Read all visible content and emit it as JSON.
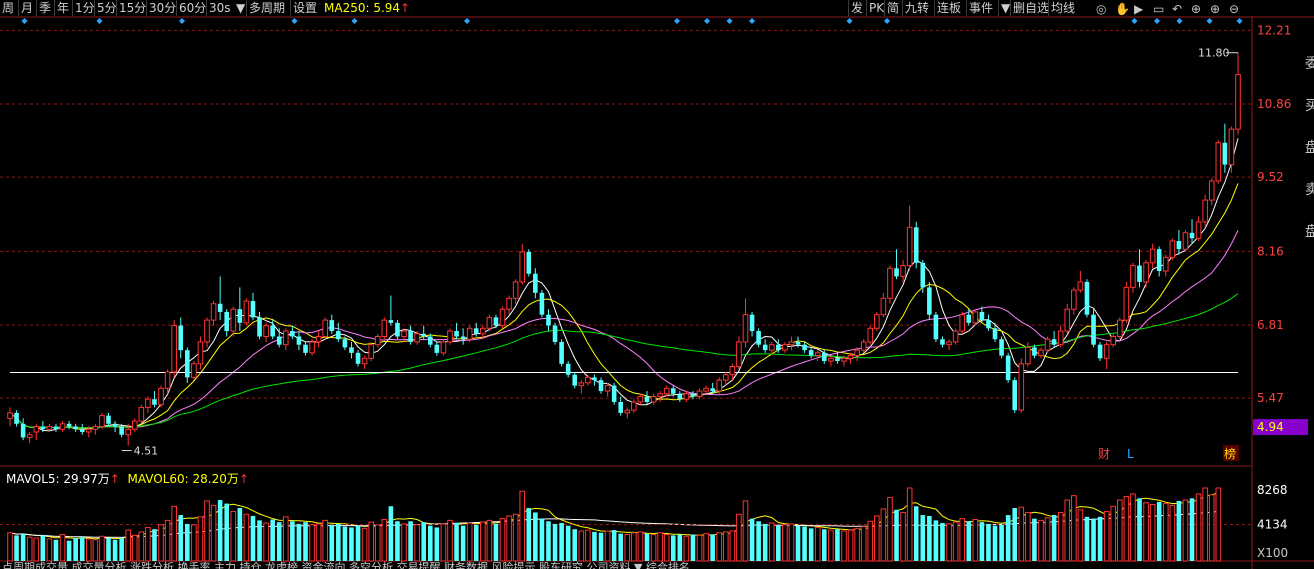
{
  "toolbar": {
    "periods": [
      "周",
      "月",
      "季",
      "年",
      "1分",
      "5分",
      "15分",
      "30分",
      "60分",
      "30s"
    ],
    "dropdown_icon": "▼",
    "multi_period": "多周期",
    "settings": "设置",
    "ma250_label": "MA250: 5.94",
    "ma250_arrow": "↑",
    "right_items": [
      "发",
      "PK",
      "简",
      "九转",
      "连板",
      "事件",
      "▼",
      "删自选",
      "均线"
    ],
    "right_icons": [
      "eye-icon",
      "hand-icon",
      "play-icon",
      "box-icon",
      "undo-icon",
      "crosshair-icon",
      "zoom-in-icon",
      "zoom-out-icon"
    ]
  },
  "price_panel": {
    "y_axis_labels": [
      "12.21",
      "10.86",
      "9.52",
      "8.16",
      "6.81",
      "5.47"
    ],
    "current_price_tag": "4.94",
    "high_label": "11.80",
    "low_label": "4.51",
    "markers": {
      "finance": "财",
      "l_marker": "L",
      "rank": "榜"
    },
    "colors": {
      "up": "#ff3232",
      "down": "#54ffff",
      "ma5": "#ffffff",
      "ma10": "#ffff00",
      "ma20": "#ff80ff",
      "ma60": "#00e600",
      "ma250": "#ffffff",
      "grid": "#8b1a1a",
      "tag_bg": "#8800cc"
    }
  },
  "volume_panel": {
    "mavol5_label": "MAVOL5: 29.97万",
    "mavol5_arrow": "↑",
    "mavol60_label": "MAVOL60: 28.20万",
    "mavol60_arrow": "↑",
    "y_axis_labels": [
      "8268",
      "4134",
      "X100"
    ]
  },
  "right_edge_text": [
    "委",
    "买",
    "盘",
    "卖",
    "盘"
  ],
  "bottom_strip_text": "点周期成交量 成交量分析 涨跌分析 换手率 主力 持仓 龙虎榜 资金流向 多空分析 交易提醒 财务数据 风险提示 股东研究 公司资料 ▼ 综合排名",
  "chart_data": {
    "type": "candlestick",
    "y_range": [
      4.3,
      12.4
    ],
    "candles": [
      [
        5.1,
        5.3,
        4.95,
        5.2
      ],
      [
        5.2,
        5.25,
        4.95,
        5.0
      ],
      [
        5.0,
        5.1,
        4.7,
        4.75
      ],
      [
        4.75,
        4.85,
        4.65,
        4.8
      ],
      [
        4.85,
        5.0,
        4.7,
        4.95
      ],
      [
        4.95,
        5.05,
        4.85,
        4.9
      ],
      [
        4.9,
        5.0,
        4.85,
        4.95
      ],
      [
        4.95,
        5.0,
        4.85,
        4.9
      ],
      [
        4.9,
        5.05,
        4.85,
        5.0
      ],
      [
        5.0,
        5.05,
        4.9,
        4.95
      ],
      [
        4.95,
        5.0,
        4.85,
        4.9
      ],
      [
        4.9,
        5.0,
        4.8,
        4.85
      ],
      [
        4.85,
        4.95,
        4.75,
        4.9
      ],
      [
        4.9,
        5.0,
        4.8,
        4.95
      ],
      [
        4.95,
        5.2,
        4.9,
        5.15
      ],
      [
        5.15,
        5.2,
        4.95,
        5.0
      ],
      [
        5.0,
        5.05,
        4.85,
        4.95
      ],
      [
        4.95,
        5.0,
        4.75,
        4.8
      ],
      [
        4.8,
        5.0,
        4.6,
        4.9
      ],
      [
        4.9,
        5.1,
        4.85,
        5.05
      ],
      [
        5.05,
        5.35,
        5.0,
        5.3
      ],
      [
        5.3,
        5.5,
        5.2,
        5.45
      ],
      [
        5.45,
        5.6,
        5.3,
        5.35
      ],
      [
        5.35,
        5.7,
        5.3,
        5.65
      ],
      [
        5.65,
        6.0,
        5.55,
        5.95
      ],
      [
        5.95,
        6.9,
        5.85,
        6.8
      ],
      [
        6.8,
        6.95,
        6.2,
        6.35
      ],
      [
        6.35,
        6.4,
        5.75,
        5.85
      ],
      [
        5.85,
        6.15,
        5.8,
        6.1
      ],
      [
        6.1,
        6.6,
        6.0,
        6.5
      ],
      [
        6.5,
        6.95,
        6.4,
        6.9
      ],
      [
        6.9,
        7.25,
        6.8,
        7.2
      ],
      [
        7.2,
        7.7,
        6.9,
        7.05
      ],
      [
        7.05,
        7.1,
        6.6,
        6.7
      ],
      [
        6.7,
        7.15,
        6.6,
        7.1
      ],
      [
        7.1,
        7.5,
        6.7,
        6.85
      ],
      [
        6.85,
        7.3,
        6.8,
        7.25
      ],
      [
        7.25,
        7.4,
        6.9,
        6.95
      ],
      [
        6.95,
        7.05,
        6.55,
        6.6
      ],
      [
        6.6,
        6.85,
        6.5,
        6.8
      ],
      [
        6.8,
        6.9,
        6.55,
        6.6
      ],
      [
        6.6,
        6.75,
        6.4,
        6.45
      ],
      [
        6.45,
        6.75,
        6.35,
        6.7
      ],
      [
        6.7,
        6.8,
        6.55,
        6.6
      ],
      [
        6.6,
        6.7,
        6.35,
        6.45
      ],
      [
        6.45,
        6.5,
        6.25,
        6.3
      ],
      [
        6.3,
        6.55,
        6.25,
        6.5
      ],
      [
        6.5,
        6.7,
        6.4,
        6.6
      ],
      [
        6.6,
        6.95,
        6.55,
        6.9
      ],
      [
        6.9,
        7.0,
        6.65,
        6.7
      ],
      [
        6.7,
        6.85,
        6.5,
        6.55
      ],
      [
        6.55,
        6.6,
        6.35,
        6.4
      ],
      [
        6.4,
        6.5,
        6.2,
        6.3
      ],
      [
        6.3,
        6.35,
        6.05,
        6.1
      ],
      [
        6.1,
        6.25,
        6.0,
        6.2
      ],
      [
        6.2,
        6.5,
        6.15,
        6.45
      ],
      [
        6.45,
        6.65,
        6.4,
        6.6
      ],
      [
        6.6,
        6.95,
        6.55,
        6.9
      ],
      [
        6.9,
        7.35,
        6.8,
        6.85
      ],
      [
        6.85,
        6.9,
        6.55,
        6.6
      ],
      [
        6.6,
        6.75,
        6.5,
        6.7
      ],
      [
        6.7,
        6.8,
        6.45,
        6.5
      ],
      [
        6.5,
        6.7,
        6.45,
        6.65
      ],
      [
        6.65,
        6.8,
        6.55,
        6.6
      ],
      [
        6.6,
        6.65,
        6.4,
        6.45
      ],
      [
        6.45,
        6.5,
        6.25,
        6.3
      ],
      [
        6.3,
        6.55,
        6.25,
        6.5
      ],
      [
        6.5,
        6.75,
        6.45,
        6.7
      ],
      [
        6.7,
        6.85,
        6.55,
        6.6
      ],
      [
        6.6,
        6.75,
        6.45,
        6.55
      ],
      [
        6.55,
        6.8,
        6.5,
        6.75
      ],
      [
        6.75,
        6.85,
        6.6,
        6.65
      ],
      [
        6.65,
        6.8,
        6.55,
        6.75
      ],
      [
        6.75,
        7.0,
        6.7,
        6.95
      ],
      [
        6.95,
        7.0,
        6.75,
        6.8
      ],
      [
        6.8,
        7.15,
        6.75,
        7.1
      ],
      [
        7.1,
        7.35,
        7.0,
        7.3
      ],
      [
        7.3,
        7.65,
        7.2,
        7.6
      ],
      [
        7.6,
        8.3,
        7.55,
        8.15
      ],
      [
        8.15,
        8.2,
        7.7,
        7.75
      ],
      [
        7.75,
        7.85,
        7.3,
        7.4
      ],
      [
        7.4,
        7.45,
        6.95,
        7.0
      ],
      [
        7.0,
        7.1,
        6.7,
        6.8
      ],
      [
        6.8,
        6.85,
        6.45,
        6.5
      ],
      [
        6.5,
        6.55,
        6.05,
        6.1
      ],
      [
        6.1,
        6.15,
        5.85,
        5.9
      ],
      [
        5.9,
        5.95,
        5.65,
        5.7
      ],
      [
        5.7,
        5.8,
        5.55,
        5.75
      ],
      [
        5.75,
        5.9,
        5.7,
        5.85
      ],
      [
        5.85,
        5.9,
        5.7,
        5.8
      ],
      [
        5.8,
        5.85,
        5.55,
        5.6
      ],
      [
        5.6,
        5.75,
        5.5,
        5.7
      ],
      [
        5.7,
        5.75,
        5.35,
        5.4
      ],
      [
        5.4,
        5.5,
        5.15,
        5.2
      ],
      [
        5.2,
        5.3,
        5.1,
        5.25
      ],
      [
        5.25,
        5.45,
        5.2,
        5.4
      ],
      [
        5.4,
        5.55,
        5.35,
        5.5
      ],
      [
        5.5,
        5.6,
        5.35,
        5.4
      ],
      [
        5.4,
        5.55,
        5.35,
        5.5
      ],
      [
        5.5,
        5.6,
        5.4,
        5.55
      ],
      [
        5.55,
        5.7,
        5.5,
        5.65
      ],
      [
        5.65,
        5.7,
        5.5,
        5.55
      ],
      [
        5.55,
        5.6,
        5.4,
        5.45
      ],
      [
        5.45,
        5.6,
        5.4,
        5.55
      ],
      [
        5.55,
        5.6,
        5.45,
        5.5
      ],
      [
        5.5,
        5.65,
        5.45,
        5.6
      ],
      [
        5.6,
        5.7,
        5.55,
        5.65
      ],
      [
        5.65,
        5.75,
        5.55,
        5.6
      ],
      [
        5.6,
        5.85,
        5.55,
        5.8
      ],
      [
        5.8,
        5.95,
        5.7,
        5.9
      ],
      [
        5.9,
        6.1,
        5.8,
        6.05
      ],
      [
        6.05,
        6.6,
        6.0,
        6.5
      ],
      [
        6.5,
        7.3,
        6.4,
        7.0
      ],
      [
        7.0,
        7.05,
        6.6,
        6.7
      ],
      [
        6.7,
        6.75,
        6.4,
        6.45
      ],
      [
        6.45,
        6.55,
        6.3,
        6.35
      ],
      [
        6.35,
        6.5,
        6.25,
        6.45
      ],
      [
        6.45,
        6.55,
        6.3,
        6.35
      ],
      [
        6.35,
        6.5,
        6.3,
        6.45
      ],
      [
        6.45,
        6.6,
        6.35,
        6.5
      ],
      [
        6.5,
        6.6,
        6.4,
        6.45
      ],
      [
        6.45,
        6.5,
        6.3,
        6.35
      ],
      [
        6.35,
        6.4,
        6.2,
        6.25
      ],
      [
        6.25,
        6.35,
        6.15,
        6.3
      ],
      [
        6.3,
        6.35,
        6.1,
        6.15
      ],
      [
        6.15,
        6.25,
        6.05,
        6.2
      ],
      [
        6.2,
        6.3,
        6.1,
        6.15
      ],
      [
        6.15,
        6.25,
        6.05,
        6.2
      ],
      [
        6.2,
        6.3,
        6.1,
        6.25
      ],
      [
        6.25,
        6.4,
        6.15,
        6.35
      ],
      [
        6.35,
        6.55,
        6.3,
        6.5
      ],
      [
        6.5,
        6.8,
        6.45,
        6.75
      ],
      [
        6.75,
        7.05,
        6.7,
        7.0
      ],
      [
        7.0,
        7.4,
        6.95,
        7.3
      ],
      [
        7.3,
        7.9,
        7.2,
        7.85
      ],
      [
        7.85,
        8.2,
        7.65,
        7.7
      ],
      [
        7.7,
        8.0,
        7.6,
        7.9
      ],
      [
        7.9,
        9.0,
        7.8,
        8.6
      ],
      [
        8.6,
        8.7,
        7.85,
        7.95
      ],
      [
        7.95,
        8.0,
        7.4,
        7.5
      ],
      [
        7.5,
        7.6,
        6.9,
        7.0
      ],
      [
        7.0,
        7.05,
        6.5,
        6.55
      ],
      [
        6.55,
        6.6,
        6.4,
        6.45
      ],
      [
        6.45,
        6.55,
        6.35,
        6.5
      ],
      [
        6.5,
        6.75,
        6.45,
        6.7
      ],
      [
        6.7,
        7.05,
        6.65,
        7.0
      ],
      [
        7.0,
        7.1,
        6.8,
        6.85
      ],
      [
        6.85,
        7.1,
        6.8,
        7.05
      ],
      [
        7.05,
        7.15,
        6.85,
        6.9
      ],
      [
        6.9,
        7.0,
        6.7,
        6.75
      ],
      [
        6.75,
        6.85,
        6.5,
        6.55
      ],
      [
        6.55,
        6.6,
        6.2,
        6.25
      ],
      [
        6.25,
        6.3,
        5.75,
        5.8
      ],
      [
        5.8,
        5.85,
        5.2,
        5.25
      ],
      [
        5.25,
        6.2,
        5.2,
        6.1
      ],
      [
        6.1,
        6.5,
        6.05,
        6.4
      ],
      [
        6.4,
        6.45,
        6.2,
        6.25
      ],
      [
        6.25,
        6.4,
        6.2,
        6.35
      ],
      [
        6.35,
        6.6,
        6.3,
        6.55
      ],
      [
        6.55,
        6.7,
        6.4,
        6.45
      ],
      [
        6.45,
        6.8,
        6.4,
        6.7
      ],
      [
        6.7,
        7.2,
        6.65,
        7.1
      ],
      [
        7.1,
        7.5,
        7.0,
        7.45
      ],
      [
        7.45,
        7.8,
        7.4,
        7.6
      ],
      [
        7.6,
        7.65,
        6.95,
        7.0
      ],
      [
        7.0,
        7.1,
        6.4,
        6.45
      ],
      [
        6.45,
        6.5,
        6.15,
        6.2
      ],
      [
        6.2,
        6.5,
        6.0,
        6.45
      ],
      [
        6.45,
        6.65,
        6.4,
        6.6
      ],
      [
        6.6,
        6.95,
        6.55,
        6.9
      ],
      [
        6.9,
        7.6,
        6.85,
        7.5
      ],
      [
        7.5,
        7.95,
        7.4,
        7.9
      ],
      [
        7.9,
        8.2,
        7.5,
        7.6
      ],
      [
        7.6,
        8.0,
        7.5,
        7.95
      ],
      [
        7.95,
        8.3,
        7.85,
        8.2
      ],
      [
        8.2,
        8.25,
        7.7,
        7.8
      ],
      [
        7.8,
        8.1,
        7.7,
        8.05
      ],
      [
        8.05,
        8.4,
        8.0,
        8.35
      ],
      [
        8.35,
        8.55,
        8.1,
        8.2
      ],
      [
        8.2,
        8.55,
        8.15,
        8.5
      ],
      [
        8.5,
        8.75,
        8.3,
        8.4
      ],
      [
        8.4,
        8.8,
        8.35,
        8.7
      ],
      [
        8.7,
        9.2,
        8.6,
        9.1
      ],
      [
        9.1,
        9.5,
        9.0,
        9.45
      ],
      [
        9.45,
        10.2,
        9.4,
        10.15
      ],
      [
        10.15,
        10.5,
        9.6,
        9.75
      ],
      [
        9.75,
        10.45,
        9.6,
        10.4
      ],
      [
        10.4,
        11.8,
        10.3,
        11.4
      ]
    ],
    "volume": [
      3200,
      2900,
      3100,
      2700,
      2600,
      2900,
      2500,
      2400,
      3000,
      2300,
      2600,
      2700,
      2500,
      2400,
      2800,
      2600,
      2400,
      2600,
      3500,
      2900,
      3300,
      3800,
      3600,
      4100,
      4600,
      6200,
      5200,
      4200,
      4100,
      5000,
      6800,
      6300,
      6900,
      6500,
      5600,
      6000,
      5300,
      5100,
      4600,
      4300,
      4700,
      4400,
      5000,
      4500,
      4200,
      4400,
      4100,
      4200,
      4600,
      4100,
      4200,
      3900,
      3800,
      4000,
      3700,
      4400,
      4100,
      4700,
      6200,
      4500,
      4200,
      4500,
      4100,
      4400,
      4000,
      3800,
      4200,
      4600,
      4300,
      4000,
      4300,
      4100,
      4400,
      4600,
      4200,
      4800,
      5100,
      5300,
      7900,
      6000,
      5500,
      4800,
      4500,
      4200,
      4300,
      4000,
      3600,
      3400,
      3500,
      3300,
      3200,
      3400,
      3500,
      3100,
      3000,
      3200,
      3300,
      3100,
      3000,
      3200,
      3000,
      2900,
      3000,
      2800,
      3000,
      2900,
      3100,
      3000,
      3200,
      3300,
      3400,
      5300,
      6800,
      4800,
      4500,
      4200,
      4300,
      4000,
      4100,
      4200,
      4000,
      3900,
      3700,
      3800,
      3600,
      3500,
      3600,
      3400,
      3500,
      3700,
      3900,
      4500,
      5100,
      5900,
      7200,
      5800,
      5500,
      8268,
      6200,
      5200,
      5100,
      4600,
      4300,
      4200,
      4400,
      4800,
      4500,
      4700,
      4400,
      4200,
      4000,
      4100,
      5200,
      6000,
      6100,
      5500,
      4800,
      4600,
      4900,
      5200,
      5500,
      6900,
      7400,
      5800,
      5000,
      4800,
      5000,
      5600,
      6200,
      6900,
      7300,
      7600,
      7100,
      6600,
      6400,
      6700,
      6500,
      6300,
      6800,
      6900,
      7100,
      7600,
      8268,
      7500,
      8268
    ]
  }
}
